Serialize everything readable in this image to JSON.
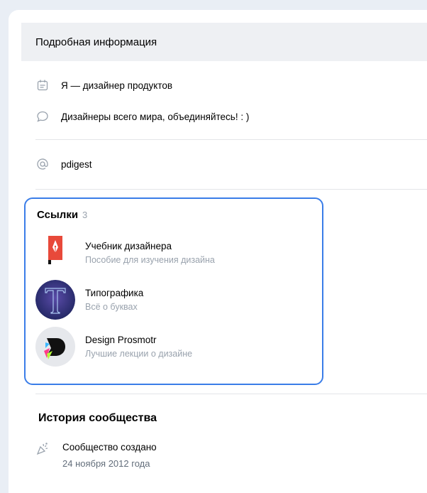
{
  "header": {
    "title": "Подробная информация"
  },
  "info": {
    "status": "Я — дизайнер продуктов",
    "motto": "Дизайнеры всего мира, объединяйтесь! : )",
    "username": "pdigest"
  },
  "links": {
    "title": "Ссылки",
    "count": "3",
    "items": [
      {
        "name": "Учебник дизайнера",
        "desc": "Пособие для изучения дизайна",
        "icon": "book-pen-logo"
      },
      {
        "name": "Типографика",
        "desc": "Всё о буквах",
        "icon": "typography-t-logo"
      },
      {
        "name": "Design Prosmotr",
        "desc": "Лучшие лекции о дизайне",
        "icon": "design-prosmotr-logo"
      }
    ]
  },
  "history": {
    "title": "История сообщества",
    "created_label": "Сообщество создано",
    "created_date": "24 ноября 2012 года"
  },
  "colors": {
    "accent": "#3a7de8",
    "secondary_text": "#99a2ad",
    "icon": "#99a2ad"
  }
}
